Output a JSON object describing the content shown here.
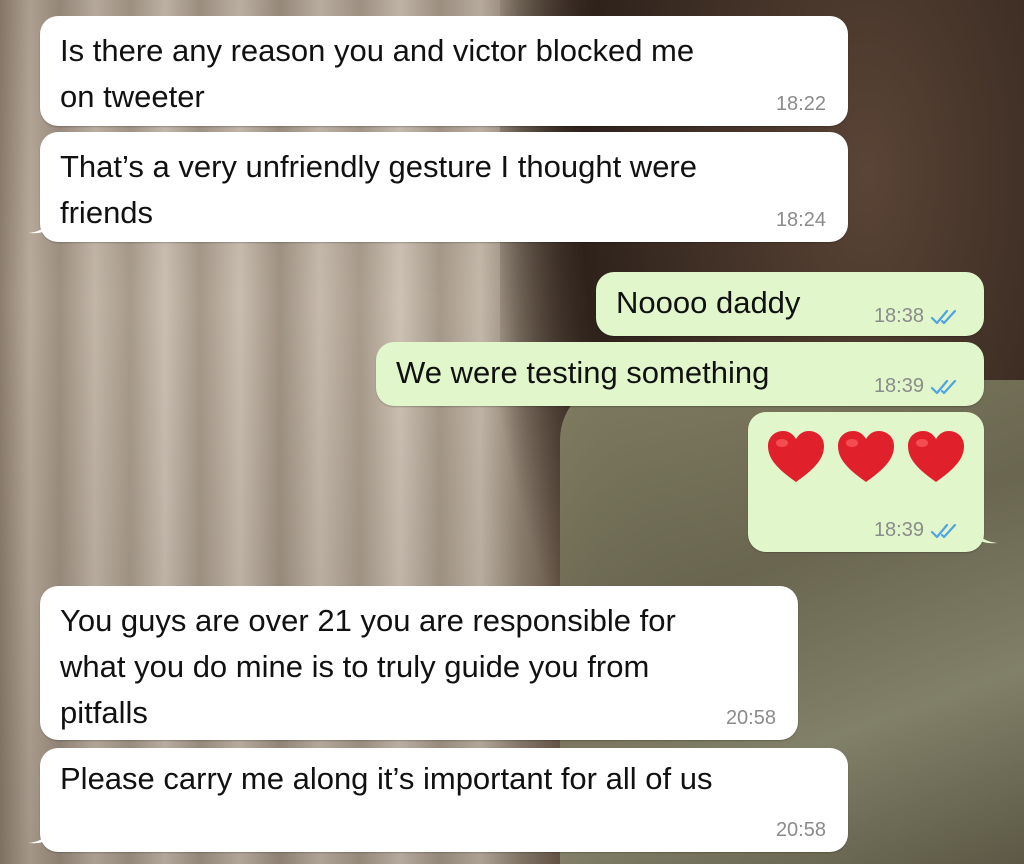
{
  "colors": {
    "incoming_bubble": "#ffffff",
    "outgoing_bubble": "#e1f7cb",
    "timestamp": "#8b8b8b",
    "read_receipt": "#4fa3e3",
    "heart": "#e0212c"
  },
  "messages": [
    {
      "direction": "incoming",
      "text_line1": "Is there any reason you and victor blocked me",
      "text_line2": "on tweeter",
      "time": "18:22"
    },
    {
      "direction": "incoming",
      "text_line1": "That’s a very unfriendly gesture I thought were",
      "text_line2": "friends",
      "time": "18:24"
    },
    {
      "direction": "outgoing",
      "text": "Noooo daddy",
      "time": "18:38",
      "status_icon": "double-check-icon"
    },
    {
      "direction": "outgoing",
      "text": "We were testing something",
      "time": "18:39",
      "status_icon": "double-check-icon"
    },
    {
      "direction": "outgoing",
      "emoji": [
        "red-heart",
        "red-heart",
        "red-heart"
      ],
      "time": "18:39",
      "status_icon": "double-check-icon"
    },
    {
      "direction": "incoming",
      "text_line1": "You guys are over 21 you are responsible for",
      "text_line2": "what you do mine is to truly guide you from",
      "text_line3": "pitfalls",
      "time": "20:58"
    },
    {
      "direction": "incoming",
      "text": "Please carry me along it’s important for all of us",
      "time": "20:58"
    }
  ]
}
